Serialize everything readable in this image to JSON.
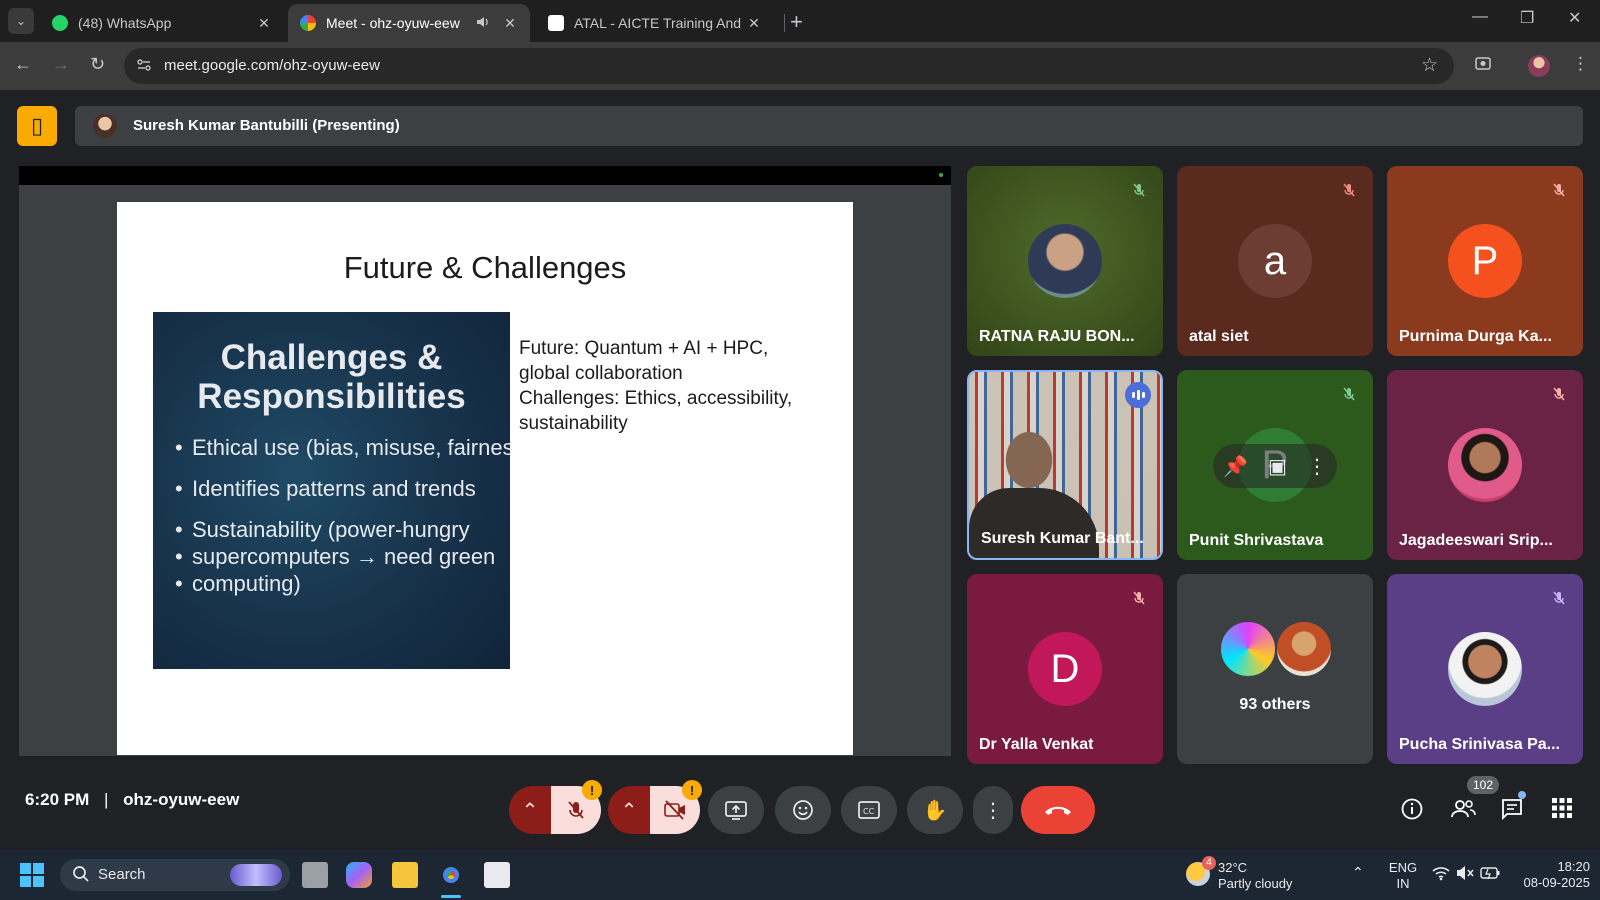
{
  "browser": {
    "tabs": [
      {
        "title": "(48) WhatsApp",
        "active": false
      },
      {
        "title": "Meet - ohz-oyuw-eew",
        "active": true
      },
      {
        "title": "ATAL - AICTE Training And Lear",
        "active": false
      }
    ],
    "url": "meet.google.com/ohz-oyuw-eew"
  },
  "meet": {
    "presenter_label": "Suresh Kumar Bantubilli (Presenting)",
    "slide": {
      "title": "Future & Challenges",
      "image_heading": "Challenges & Responsibilities",
      "image_bullets": [
        "Ethical use (bias, misuse, fairness)",
        "Identifies patterns and trends",
        "Sustainability (power-hungry",
        "supercomputers → need green",
        "computing)"
      ],
      "text_lines": [
        "Future: Quantum + AI + HPC,",
        "global collaboration",
        "Challenges: Ethics, accessibility,",
        "sustainability"
      ]
    },
    "participants": [
      {
        "name": "RATNA RAJU BON...",
        "type": "photo",
        "muted": true
      },
      {
        "name": "atal siet",
        "type": "letter",
        "letter": "a",
        "muted": true
      },
      {
        "name": "Purnima Durga Ka...",
        "type": "letter",
        "letter": "P",
        "muted": true
      },
      {
        "name": "Suresh Kumar Bant...",
        "type": "video",
        "speaking": true
      },
      {
        "name": "Punit Shrivastava",
        "type": "letter",
        "letter": "P",
        "muted": true
      },
      {
        "name": "Jagadeeswari Srip...",
        "type": "photo",
        "muted": true
      },
      {
        "name": "Dr Yalla Venkat",
        "type": "letter",
        "letter": "D",
        "muted": true
      },
      {
        "name": "93 others",
        "type": "others"
      },
      {
        "name": "Pucha Srinivasa Pa...",
        "type": "photo",
        "muted": true
      }
    ],
    "time": "6:20 PM",
    "meeting_code": "ohz-oyuw-eew",
    "participant_count": "102"
  },
  "taskbar": {
    "search_label": "Search",
    "weather_temp": "32°C",
    "weather_desc": "Partly cloudy",
    "weather_badge": "4",
    "lang": "ENG",
    "region": "IN",
    "clock_time": "18:20",
    "clock_date": "08-09-2025"
  },
  "colors": {
    "meet_bg": "#202124",
    "accent_yellow": "#f9ab00",
    "end_call_red": "#ea4335",
    "speaking_blue": "#4c6ed8"
  }
}
